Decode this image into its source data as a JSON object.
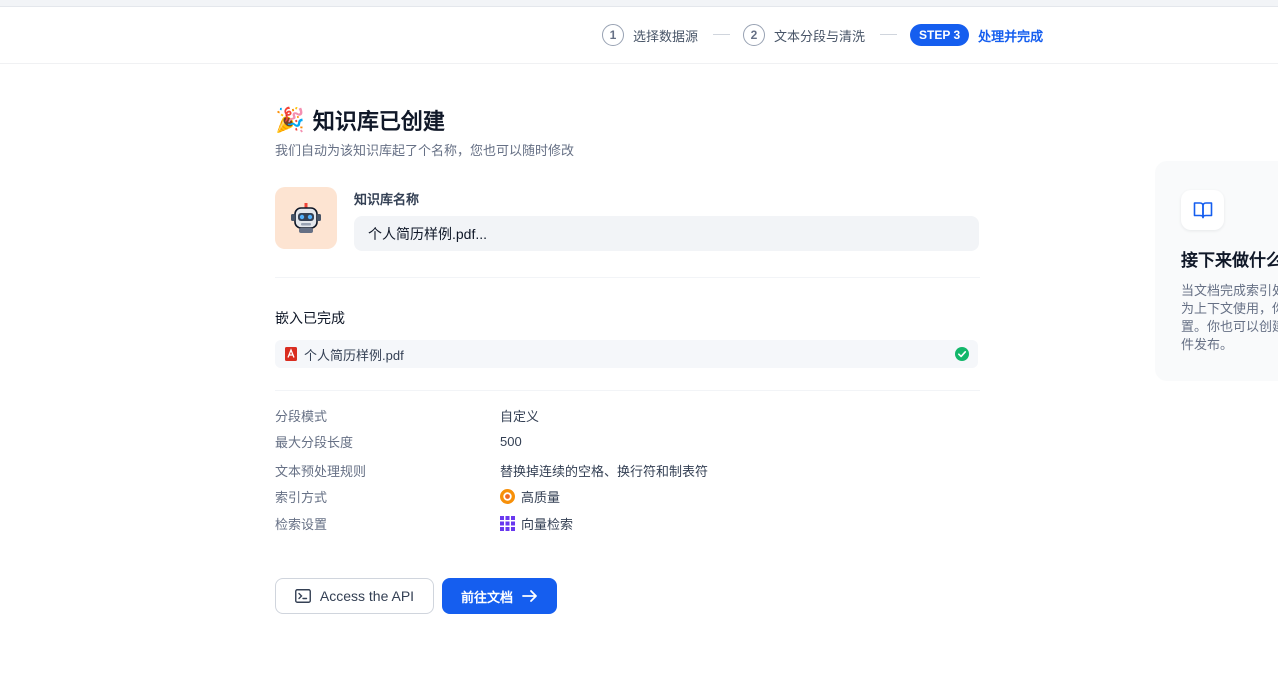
{
  "steps": [
    {
      "num": "1",
      "label": "选择数据源"
    },
    {
      "num": "2",
      "label": "文本分段与清洗"
    },
    {
      "num": "STEP 3",
      "label": "处理并完成"
    }
  ],
  "header": {
    "emoji": "🎉",
    "title": "知识库已创建",
    "subtitle": "我们自动为该知识库起了个名称，您也可以随时修改"
  },
  "knowledge_base": {
    "name_label": "知识库名称",
    "name_value": "个人简历样例.pdf..."
  },
  "embedding": {
    "title": "嵌入已完成",
    "file_name": "个人简历样例.pdf",
    "status_color": "#12b76a"
  },
  "settings": [
    {
      "key": "分段模式",
      "value": "自定义"
    },
    {
      "key": "最大分段长度",
      "value": "500"
    },
    {
      "key": "文本预处理规则",
      "value": "替换掉连续的空格、换行符和制表符"
    },
    {
      "key": "索引方式",
      "value": "高质量",
      "icon": "high-quality-icon"
    },
    {
      "key": "检索设置",
      "value": "向量检索",
      "icon": "vector-grid-icon"
    }
  ],
  "actions": {
    "api_label": "Access the API",
    "go_doc_label": "前往文档"
  },
  "next_panel": {
    "title": "接下来做什么",
    "desc_lines": [
      "当文档完成索引处理后，",
      "为上下文使用，你",
      "置。你也可以创建",
      "件发布。"
    ]
  },
  "colors": {
    "primary": "#155eef",
    "avatar_bg": "#fde4d2",
    "pdf_red": "#d92d20"
  }
}
